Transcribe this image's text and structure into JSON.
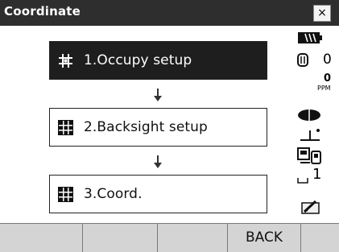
{
  "window": {
    "title": "Coordinate",
    "close_label": "×"
  },
  "steps": [
    {
      "label": "1.Occupy setup",
      "icon": "occupy-grid-icon",
      "selected": true
    },
    {
      "label": "2.Backsight setup",
      "icon": "grid-icon",
      "selected": false
    },
    {
      "label": "3.Coord.",
      "icon": "grid-icon",
      "selected": false
    }
  ],
  "status": {
    "battery": "battery-icon",
    "prism_constant": "0",
    "ppm_value": "0",
    "ppm_unit": "PPM",
    "target": "prism-target-icon",
    "tilt": "tilt-icon",
    "comm": "communication-icon",
    "page_number": "1",
    "input_mode": "input-mode-icon"
  },
  "softkeys": [
    "",
    "",
    "",
    "BACK",
    ""
  ],
  "colors": {
    "titlebar": "#2e2e2e",
    "selected_step": "#1e1e1e",
    "softkey_bar": "#d4d4d4"
  }
}
